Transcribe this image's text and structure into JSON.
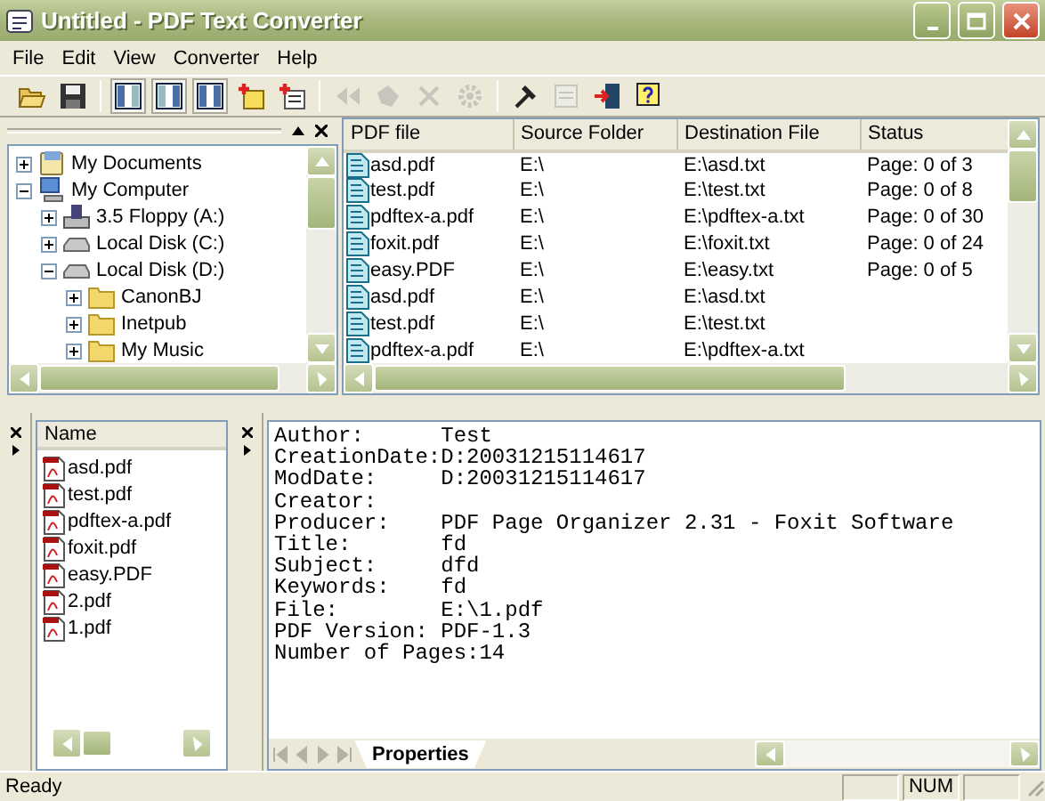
{
  "window": {
    "title": "Untitled - PDF Text Converter"
  },
  "menu": [
    "File",
    "Edit",
    "View",
    "Converter",
    "Help"
  ],
  "toolbar": [
    [
      {
        "kind": "open",
        "disabled": false
      },
      {
        "kind": "save",
        "disabled": false
      }
    ],
    [
      {
        "kind": "layout-left",
        "disabled": false
      },
      {
        "kind": "layout-center",
        "disabled": false
      },
      {
        "kind": "layout-right",
        "disabled": false
      },
      {
        "kind": "add-file",
        "disabled": false
      },
      {
        "kind": "add-list",
        "disabled": false
      }
    ],
    [
      {
        "kind": "first",
        "disabled": true
      },
      {
        "kind": "previous",
        "disabled": true
      },
      {
        "kind": "delete",
        "disabled": true
      },
      {
        "kind": "gear",
        "disabled": true
      }
    ],
    [
      {
        "kind": "hammer",
        "disabled": false
      },
      {
        "kind": "document",
        "disabled": true
      },
      {
        "kind": "exit",
        "disabled": false
      },
      {
        "kind": "help",
        "disabled": false
      }
    ]
  ],
  "tree": [
    {
      "label": "My Documents",
      "kind": "documents",
      "expanded": false
    },
    {
      "label": "My Computer",
      "kind": "computer",
      "expanded": true,
      "children": [
        {
          "label": "3.5 Floppy (A:)",
          "kind": "floppy",
          "expanded": false
        },
        {
          "label": "Local Disk (C:)",
          "kind": "drive",
          "expanded": false
        },
        {
          "label": "Local Disk (D:)",
          "kind": "drive",
          "expanded": true,
          "children": [
            {
              "label": "CanonBJ",
              "kind": "folder",
              "expanded": false
            },
            {
              "label": "Inetpub",
              "kind": "folder",
              "expanded": false
            },
            {
              "label": "My Music",
              "kind": "folder",
              "expanded": false
            }
          ]
        }
      ]
    }
  ],
  "file_table": {
    "columns": [
      "PDF file",
      "Source Folder",
      "Destination File",
      "Status"
    ],
    "rows": [
      {
        "pdf_file": "asd.pdf",
        "source_folder": "E:\\",
        "destination_file": "E:\\asd.txt",
        "status": "Page: 0 of 3"
      },
      {
        "pdf_file": "test.pdf",
        "source_folder": "E:\\",
        "destination_file": "E:\\test.txt",
        "status": "Page: 0 of 8"
      },
      {
        "pdf_file": "pdftex-a.pdf",
        "source_folder": "E:\\",
        "destination_file": "E:\\pdftex-a.txt",
        "status": "Page: 0 of 30"
      },
      {
        "pdf_file": "foxit.pdf",
        "source_folder": "E:\\",
        "destination_file": "E:\\foxit.txt",
        "status": "Page: 0 of 24"
      },
      {
        "pdf_file": "easy.PDF",
        "source_folder": "E:\\",
        "destination_file": "E:\\easy.txt",
        "status": "Page: 0 of 5"
      },
      {
        "pdf_file": "asd.pdf",
        "source_folder": "E:\\",
        "destination_file": "E:\\asd.txt"
      },
      {
        "pdf_file": "test.pdf",
        "source_folder": "E:\\",
        "destination_file": "E:\\test.txt"
      },
      {
        "pdf_file": "pdftex-a.pdf",
        "source_folder": "E:\\",
        "destination_file": "E:\\pdftex-a.txt"
      }
    ]
  },
  "file_list": {
    "header": "Name",
    "items": [
      "asd.pdf",
      "test.pdf",
      "pdftex-a.pdf",
      "foxit.pdf",
      "easy.PDF",
      "2.pdf",
      "1.pdf"
    ]
  },
  "properties": {
    "lines": [
      "Author:      Test",
      "CreationDate:D:20031215114617",
      "ModDate:     D:20031215114617",
      "Creator:",
      "Producer:    PDF Page Organizer 2.31 - Foxit Software",
      "Title:       fd",
      "Subject:     dfd",
      "Keywords:    fd",
      "File:        E:\\1.pdf",
      "PDF Version: PDF-1.3",
      "Number of Pages:14"
    ],
    "tabs": [
      {
        "label": "Properties",
        "selected": true
      }
    ]
  },
  "status_bar": {
    "text": "Ready",
    "indicators": [
      "NUM"
    ]
  }
}
